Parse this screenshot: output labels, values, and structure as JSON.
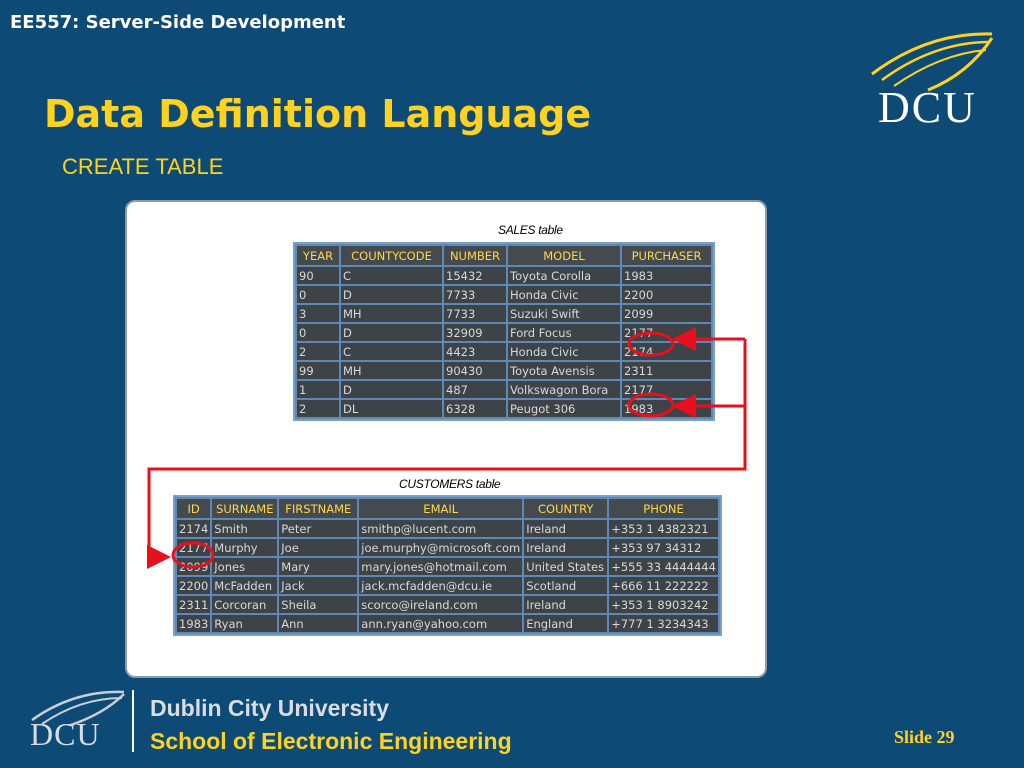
{
  "header": {
    "course": "EE557: Server-Side Development",
    "title": "Data Definition Language",
    "subtitle": "CREATE TABLE"
  },
  "logo": {
    "text": "DCU"
  },
  "sales_table": {
    "title": "SALES table",
    "columns": [
      "YEAR",
      "COUNTYCODE",
      "NUMBER",
      "MODEL",
      "PURCHASER"
    ],
    "rows": [
      [
        "90",
        "C",
        "15432",
        "Toyota Corolla",
        "1983"
      ],
      [
        "0",
        "D",
        "7733",
        "Honda Civic",
        "2200"
      ],
      [
        "3",
        "MH",
        "7733",
        "Suzuki Swift",
        "2099"
      ],
      [
        "0",
        "D",
        "32909",
        "Ford Focus",
        "2177"
      ],
      [
        "2",
        "C",
        "4423",
        "Honda Civic",
        "2174"
      ],
      [
        "99",
        "MH",
        "90430",
        "Toyota Avensis",
        "2311"
      ],
      [
        "1",
        "D",
        "487",
        "Volkswagon Bora",
        "2177"
      ],
      [
        "2",
        "DL",
        "6328",
        "Peugot 306",
        "1983"
      ]
    ]
  },
  "customers_table": {
    "title": "CUSTOMERS table",
    "columns": [
      "ID",
      "SURNAME",
      "FIRSTNAME",
      "EMAIL",
      "COUNTRY",
      "PHONE"
    ],
    "rows": [
      [
        "2174",
        "Smith",
        "Peter",
        "smithp@lucent.com",
        "Ireland",
        "+353 1 4382321"
      ],
      [
        "2177",
        "Murphy",
        "Joe",
        "joe.murphy@microsoft.com",
        "Ireland",
        "+353 97 34312"
      ],
      [
        "2099",
        "Jones",
        "Mary",
        "mary.jones@hotmail.com",
        "United States",
        "+555 33 4444444"
      ],
      [
        "2200",
        "McFadden",
        "Jack",
        "jack.mcfadden@dcu.ie",
        "Scotland",
        "+666 11 222222"
      ],
      [
        "2311",
        "Corcoran",
        "Sheila",
        "scorco@ireland.com",
        "Ireland",
        "+353 1 8903242"
      ],
      [
        "1983",
        "Ryan",
        "Ann",
        "ann.ryan@yahoo.com",
        "England",
        "+777 1 3234343"
      ]
    ]
  },
  "footer": {
    "logo_text": "DCU",
    "university": "Dublin City University",
    "school": "School of Electronic Engineering",
    "slide": "Slide 29"
  },
  "colors": {
    "background": "#0e4a76",
    "accent_yellow": "#ffd21f",
    "annotation_red": "#e8101c",
    "header_text": "#ffd84a"
  }
}
